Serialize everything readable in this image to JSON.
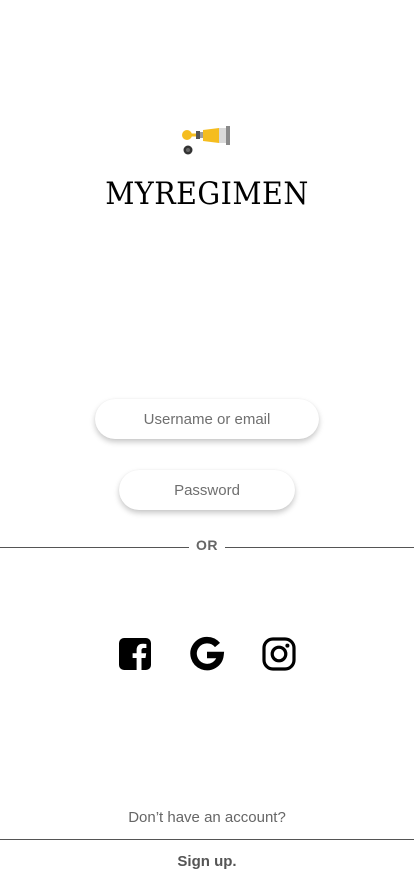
{
  "app": {
    "title": "MYREGIMEN",
    "logo_icon": "paint-tube-icon"
  },
  "login": {
    "username_placeholder": "Username or email",
    "password_placeholder": "Password",
    "divider_text": "OR"
  },
  "social": {
    "facebook_icon": "facebook-icon",
    "google_icon": "google-icon",
    "instagram_icon": "instagram-icon"
  },
  "footer": {
    "prompt": "Don’t have an account?",
    "signup_label": "Sign up."
  },
  "colors": {
    "background": "#ffffff",
    "logo_yellow": "#f5bd1f",
    "logo_gray": "#9e9e9e",
    "text_muted": "#666666"
  }
}
